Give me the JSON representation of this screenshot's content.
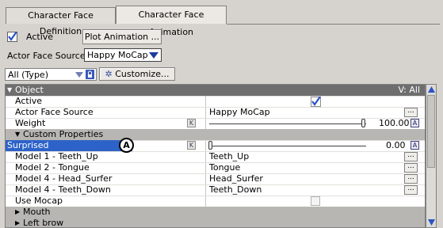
{
  "tabs": [
    {
      "label": "Character Face Definition",
      "active": false
    },
    {
      "label": "Character Face Animation",
      "active": true
    }
  ],
  "controls": {
    "active_label": "Active",
    "active_checked": true,
    "plot_button": "Plot Animation ...",
    "source_label": "Actor Face Source:",
    "source_value": "Happy MoCap"
  },
  "filter": {
    "type_value": "All (Type)",
    "customize_label": "Customize..."
  },
  "grid": {
    "header": {
      "label": "Object",
      "right": "V: All"
    },
    "rows": {
      "active": {
        "name": "Active"
      },
      "source": {
        "name": "Actor Face Source",
        "value": "Happy MoCap"
      },
      "weight": {
        "name": "Weight",
        "value": "100.00"
      },
      "custom": {
        "name": "Custom Properties"
      },
      "surprised": {
        "name": "Surprised",
        "value": "0.00"
      },
      "teeth_up": {
        "name": "Model 1 - Teeth_Up",
        "value": "Teeth_Up"
      },
      "tongue": {
        "name": "Model 2 - Tongue",
        "value": "Tongue"
      },
      "head_surfer": {
        "name": "Model 4 - Head_Surfer",
        "value": "Head_Surfer"
      },
      "teeth_down": {
        "name": "Model 4 - Teeth_Down",
        "value": "Teeth_Down"
      },
      "use_mocap": {
        "name": "Use Mocap"
      },
      "mouth": {
        "name": "Mouth"
      },
      "left_brow": {
        "name": "Left brow"
      }
    },
    "k": "K",
    "a": "A",
    "dots": "...",
    "callout": "A"
  },
  "colors": {
    "selection": "#2d62c8",
    "accent_check": "#2a54c6"
  }
}
